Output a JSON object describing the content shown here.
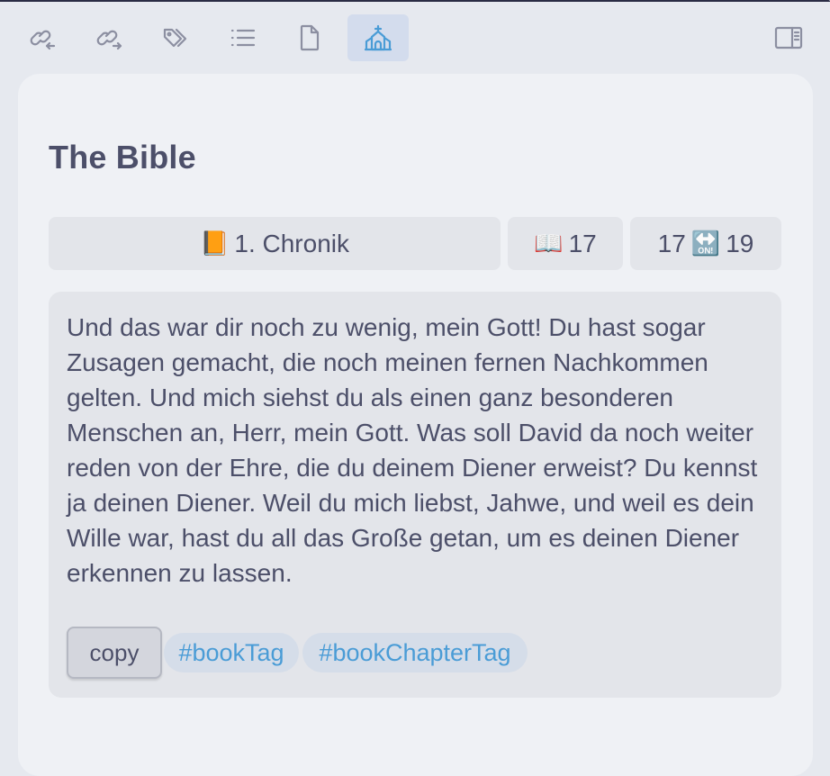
{
  "toolbar": {
    "icons": [
      {
        "name": "backlinks-icon"
      },
      {
        "name": "outgoing-links-icon"
      },
      {
        "name": "tags-icon"
      },
      {
        "name": "outline-icon"
      },
      {
        "name": "file-icon"
      },
      {
        "name": "church-icon",
        "active": true
      },
      {
        "name": "sidebar-toggle-icon"
      }
    ]
  },
  "panel": {
    "title": "The Bible",
    "selectors": {
      "book_emoji": "📙",
      "book": "1. Chronik",
      "chapter_emoji": "📖",
      "chapter": "17",
      "verse_from": "17",
      "range_emoji": "🔛",
      "verse_to": "19"
    },
    "verse_text": "Und das war dir noch zu wenig, mein Gott! Du hast sogar Zusagen gemacht, die noch meinen fernen Nachkommen gelten. Und mich siehst du als einen ganz besonderen Menschen an, Herr, mein Gott. Was soll David da noch weiter reden von der Ehre, die du deinem Diener erweist? Du kennst ja deinen Diener. Weil du mich liebst, Jahwe, und weil es dein Wille war, hast du all das Große getan, um es deinen Diener erkennen zu lassen.",
    "copy_label": "copy",
    "tags": [
      "#bookTag",
      "#bookChapterTag"
    ]
  },
  "colors": {
    "background": "#e6e9ef",
    "panel": "#eff1f5",
    "card": "#e3e5ea",
    "text": "#4c4f69",
    "icon": "#8c8fa1",
    "accent": "#4a9cd6",
    "active_tab": "#d3dced"
  }
}
